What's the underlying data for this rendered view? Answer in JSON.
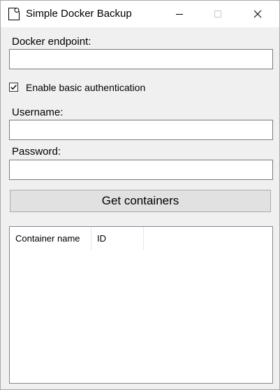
{
  "window": {
    "title": "Simple Docker Backup"
  },
  "form": {
    "endpoint_label": "Docker endpoint:",
    "endpoint_value": "",
    "basic_auth_label": "Enable basic authentication",
    "basic_auth_checked": true,
    "username_label": "Username:",
    "username_value": "",
    "password_label": "Password:",
    "password_value": "",
    "get_containers_label": "Get containers"
  },
  "containers_list": {
    "columns": [
      "Container name",
      "ID"
    ],
    "rows": []
  }
}
